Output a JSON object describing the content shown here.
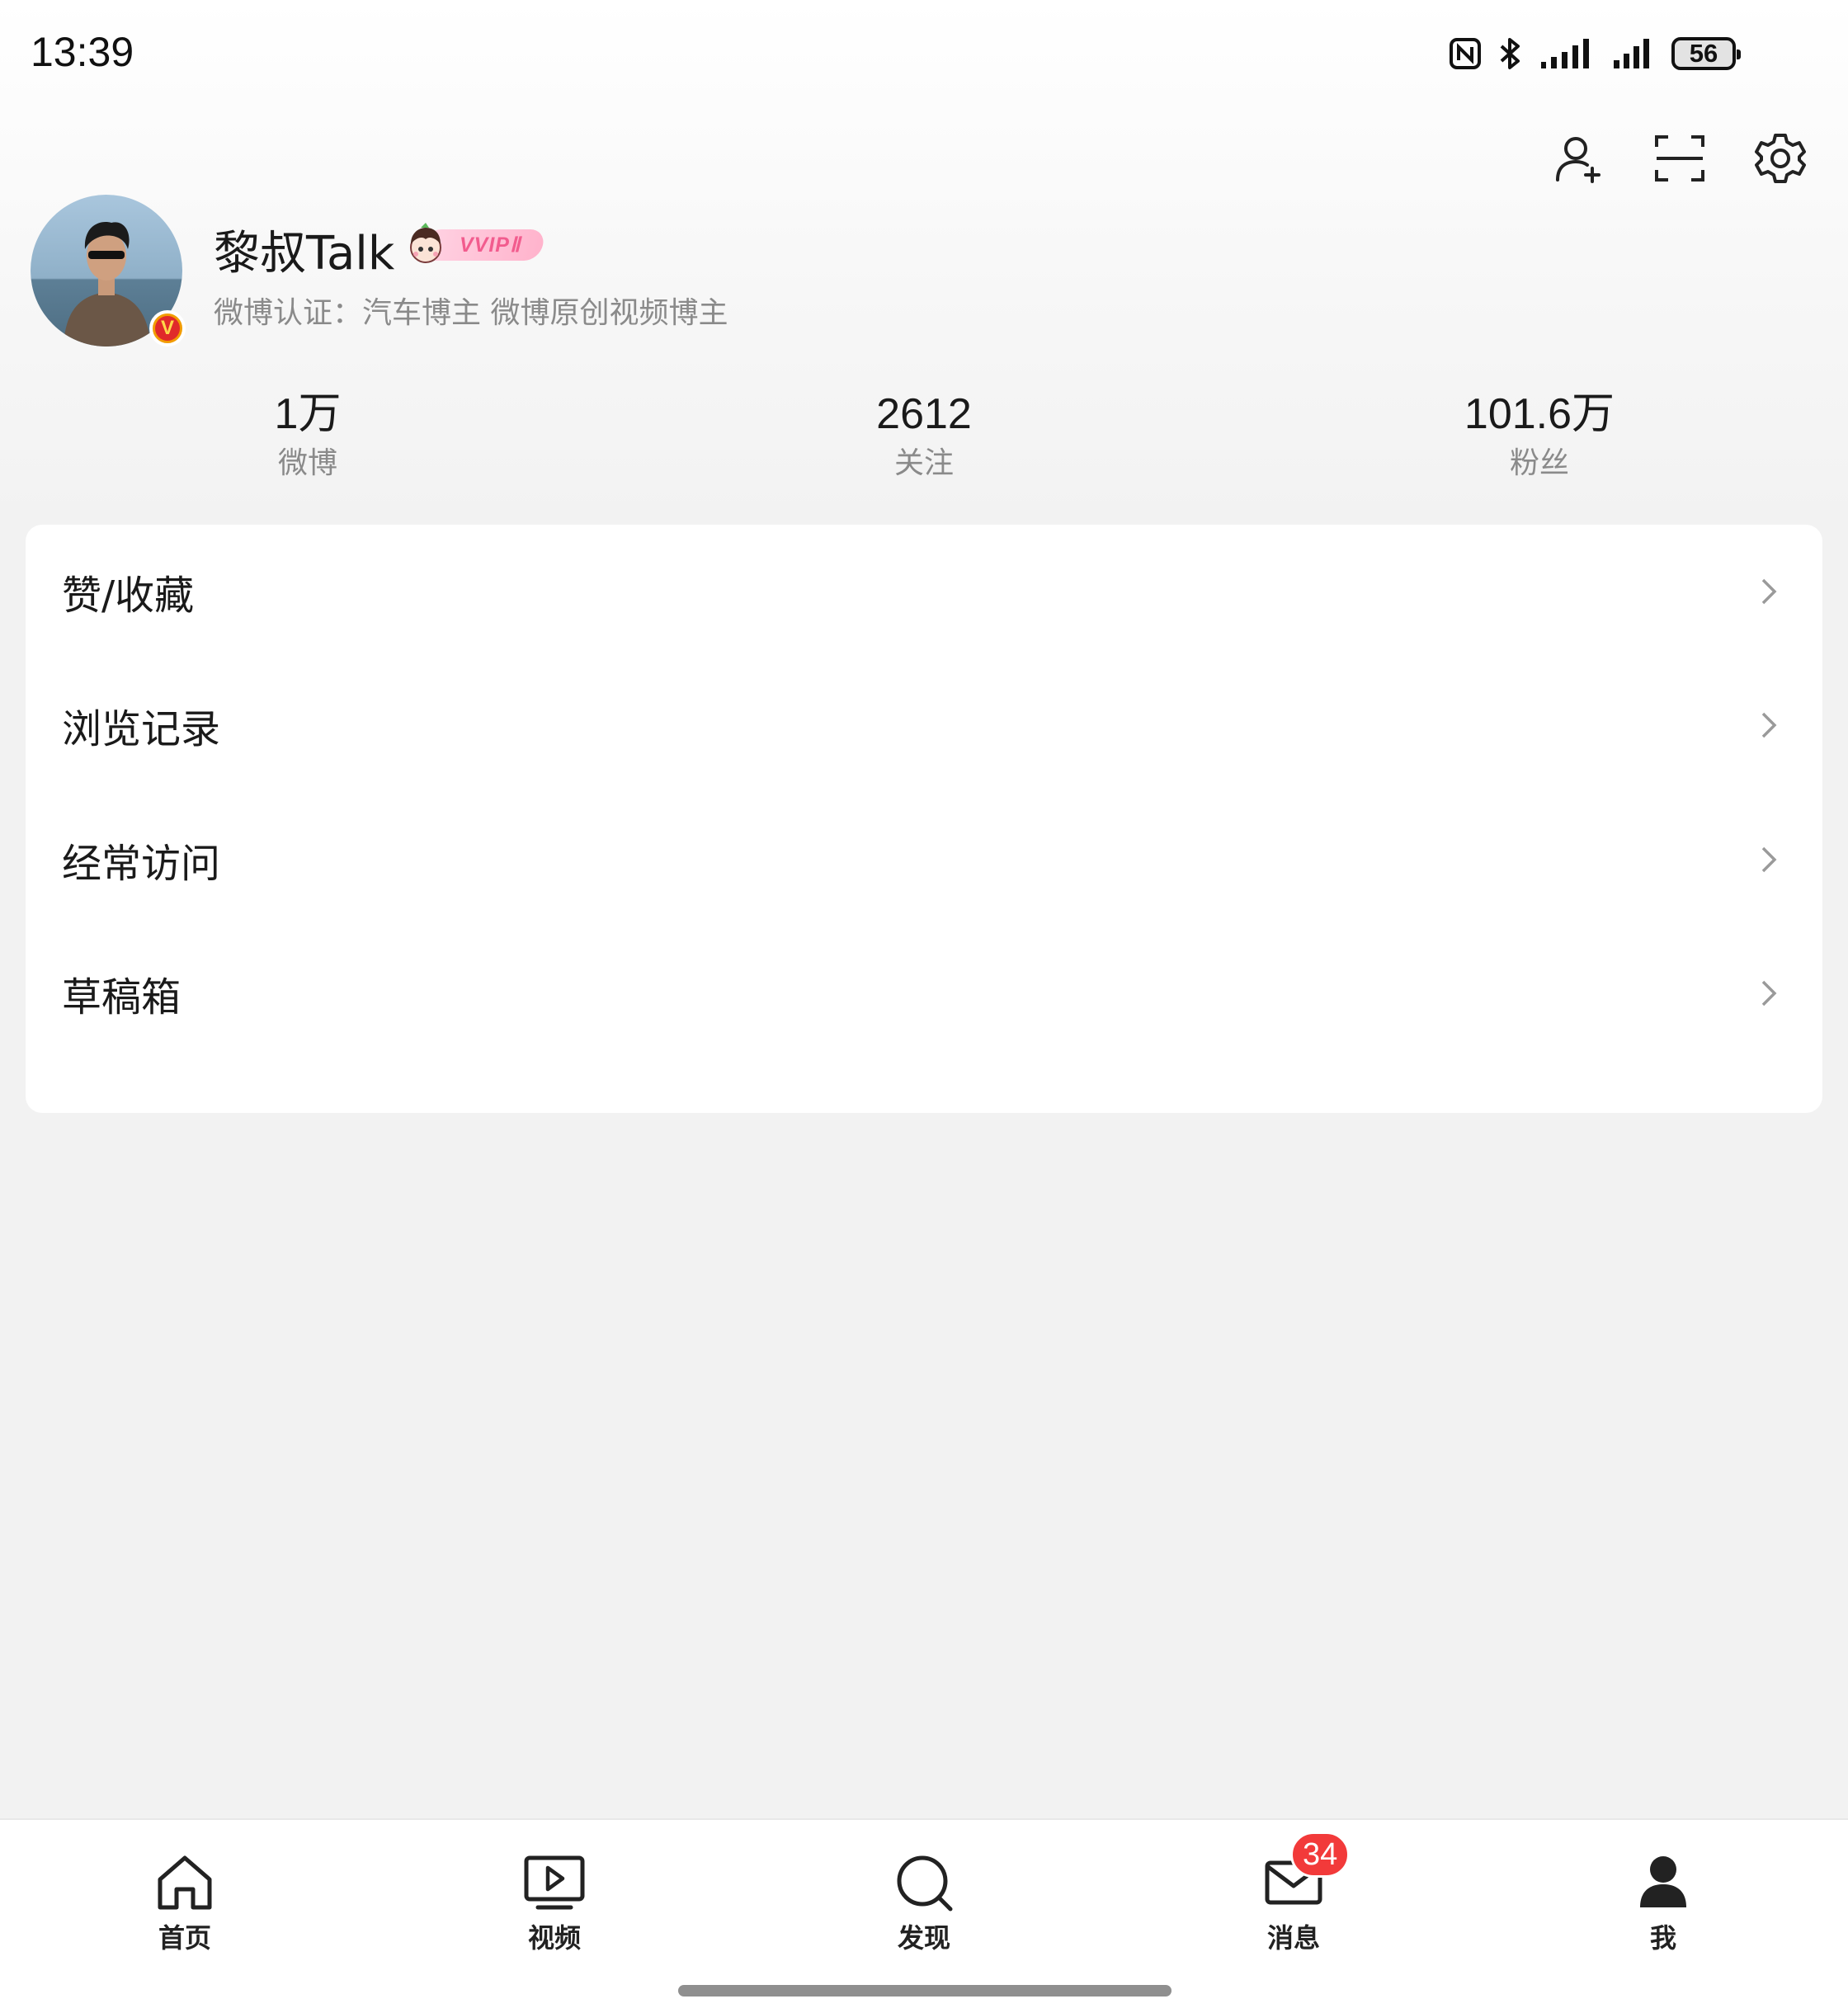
{
  "status_bar": {
    "time": "13:39",
    "battery": "56",
    "icons": [
      "nfc-icon",
      "bluetooth-icon",
      "signal-icon",
      "signal-icon",
      "battery-icon"
    ]
  },
  "header": {
    "actions": [
      "add-friend-icon",
      "scan-icon",
      "settings-icon"
    ]
  },
  "profile": {
    "name": "黎叔Talk",
    "vip_label": "VVIPⅡ",
    "verification": "微博认证：汽车博主 微博原创视频博主"
  },
  "stats": [
    {
      "value": "1万",
      "label": "微博"
    },
    {
      "value": "2612",
      "label": "关注"
    },
    {
      "value": "101.6万",
      "label": "粉丝"
    }
  ],
  "menu": [
    {
      "label": "赞/收藏"
    },
    {
      "label": "浏览记录"
    },
    {
      "label": "经常访问"
    },
    {
      "label": "草稿箱"
    }
  ],
  "bottom_nav": [
    {
      "label": "首页",
      "icon": "home-icon"
    },
    {
      "label": "视频",
      "icon": "video-icon"
    },
    {
      "label": "发现",
      "icon": "search-icon"
    },
    {
      "label": "消息",
      "icon": "mail-icon",
      "badge": "34"
    },
    {
      "label": "我",
      "icon": "profile-icon"
    }
  ],
  "colors": {
    "accent_badge": "#f23a3a",
    "vip_pink": "#f25c8e",
    "secondary_text": "#8a8a8a"
  }
}
